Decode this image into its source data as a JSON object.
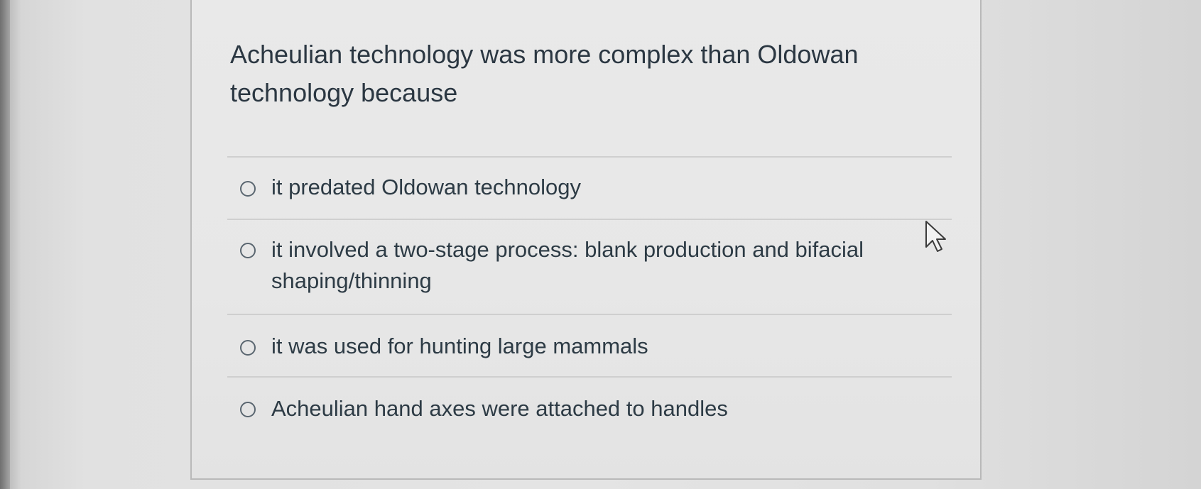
{
  "question": {
    "text": "Acheulian technology was more complex than Oldowan technology because"
  },
  "answers": [
    {
      "label": "it predated Oldowan technology",
      "selected": false
    },
    {
      "label": "it involved a two-stage process: blank production and bifacial shaping/thinning",
      "selected": false
    },
    {
      "label": "it was used for hunting large mammals",
      "selected": false
    },
    {
      "label": "Acheulian hand axes were attached to handles",
      "selected": false
    }
  ],
  "icons": {
    "radio": "radio-unchecked-icon",
    "cursor": "mouse-pointer-icon"
  }
}
